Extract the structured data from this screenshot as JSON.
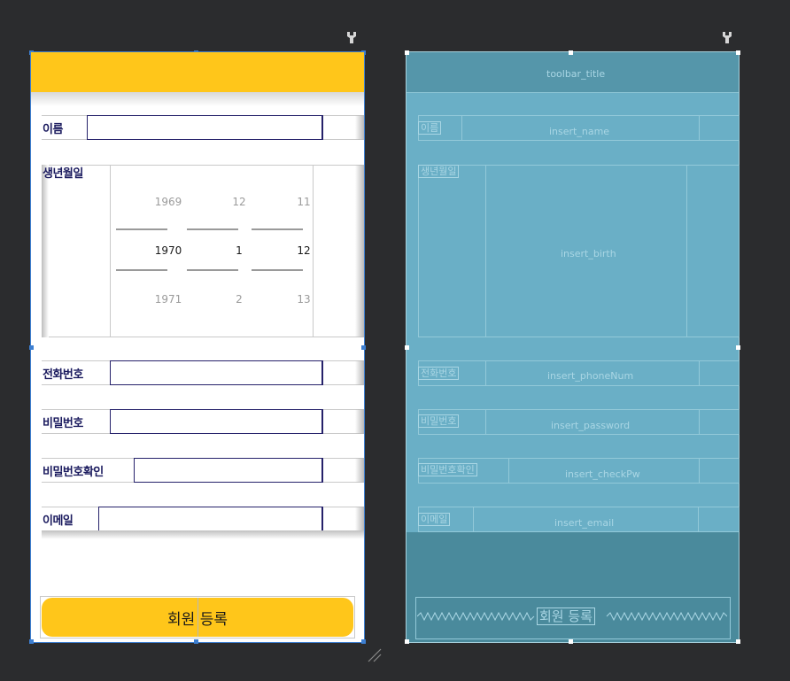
{
  "design": {
    "labels": {
      "name": "이름",
      "birth": "생년월일",
      "phone": "전화번호",
      "password": "비밀번호",
      "check_password": "비밀번호확인",
      "email": "이메일"
    },
    "picker": {
      "year": {
        "prev": "1969",
        "current": "1970",
        "next": "1971"
      },
      "month": {
        "prev": "12",
        "current": "1",
        "next": "2"
      },
      "day": {
        "prev": "11",
        "current": "12",
        "next": "13"
      }
    },
    "register_button": "회원 등록"
  },
  "blueprint": {
    "toolbar_title": "toolbar_title",
    "labels": {
      "name": "이름",
      "birth": "생년월일",
      "phone": "전화번호",
      "password": "비밀번호",
      "check_password": "비밀번호확인",
      "email": "이메일"
    },
    "ids": {
      "name": "insert_name",
      "birth": "insert_birth",
      "phone": "insert_phoneNum",
      "password": "insert_password",
      "check_password": "insert_checkPw",
      "email": "insert_email"
    },
    "register_button": "회원 등록"
  },
  "colors": {
    "accent": "#ffc61a",
    "field_border": "#25216a",
    "blueprint": "#6aafc6",
    "selection": "#3d7fd1"
  },
  "icons": [
    "pin-icon",
    "resize-handle-icon"
  ]
}
